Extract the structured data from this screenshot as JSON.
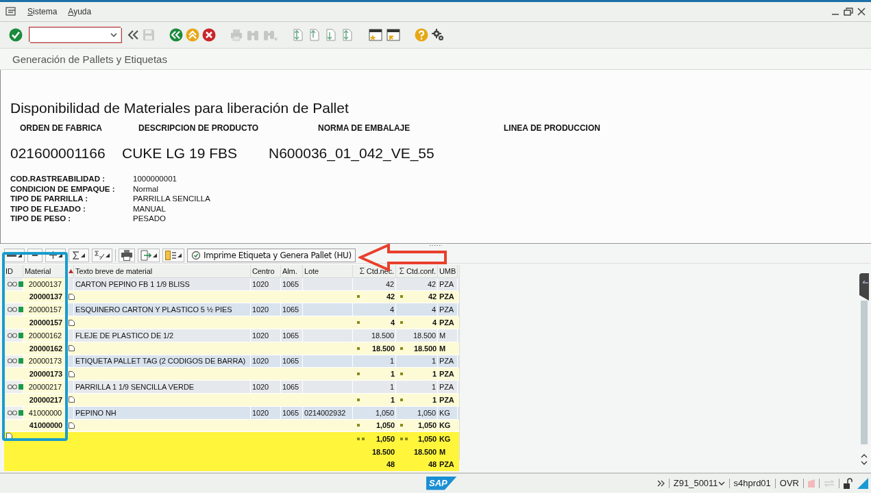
{
  "menu": [
    {
      "label": "Sistema"
    },
    {
      "label": "Ayuda"
    }
  ],
  "screen_title": "Generación de Pallets y Etiquetas",
  "header": {
    "title": "Disponibilidad de Materiales para liberación de Pallet",
    "columns": [
      "ORDEN DE FABRICA",
      "DESCRIPCION DE PRODUCTO",
      "NORMA DE EMBALAJE",
      "LINEA DE PRODUCCION"
    ],
    "values": [
      "021600001166",
      "CUKE LG 19 FBS",
      "N600036_01_042_VE_55"
    ],
    "details": [
      {
        "label": "COD.RASTREABILIDAD :",
        "value": "1000000001"
      },
      {
        "label": "CONDICION DE EMPAQUE :",
        "value": "Normal"
      },
      {
        "label": "TIPO DE PARRILLA :",
        "value": "PARRILLA SENCILLA"
      },
      {
        "label": "TIPO DE FLEJADO :",
        "value": "MANUAL"
      },
      {
        "label": "TIPO DE PESO :",
        "value": "PESADO"
      }
    ]
  },
  "grid": {
    "action_button": "Imprime Etiqueta y Genera Pallet (HU)",
    "columns": [
      {
        "label": "ID",
        "sum": false
      },
      {
        "label": "Material",
        "sum": false
      },
      {
        "label": "Texto breve de material",
        "sum": false
      },
      {
        "label": "Centro",
        "sum": false
      },
      {
        "label": "Alm.",
        "sum": false
      },
      {
        "label": "Lote",
        "sum": false
      },
      {
        "label": "Ctd.nec.",
        "sum": true
      },
      {
        "label": "Ctd.conf.",
        "sum": true
      },
      {
        "label": "UMB",
        "sum": false
      }
    ],
    "rows": [
      {
        "kind": "item",
        "material": "20000137",
        "text": "CARTON PEPINO FB 1 1/9 BLISS",
        "centro": "1020",
        "alm": "1065",
        "lote": "",
        "nec": "42",
        "conf": "42",
        "umb": "PZA"
      },
      {
        "kind": "subtotal",
        "material": "20000137",
        "nec": "42",
        "conf": "42",
        "umb": "PZA"
      },
      {
        "kind": "item",
        "material": "20000157",
        "text": "ESQUINERO CARTON Y PLASTICO 5 ½ PIES",
        "centro": "1020",
        "alm": "1065",
        "lote": "",
        "nec": "4",
        "conf": "4",
        "umb": "PZA"
      },
      {
        "kind": "subtotal",
        "material": "20000157",
        "nec": "4",
        "conf": "4",
        "umb": "PZA"
      },
      {
        "kind": "item",
        "material": "20000162",
        "text": "FLEJE DE PLASTICO DE 1/2",
        "centro": "1020",
        "alm": "1065",
        "lote": "",
        "nec": "18.500",
        "conf": "18.500",
        "umb": "M"
      },
      {
        "kind": "subtotal",
        "material": "20000162",
        "nec": "18.500",
        "conf": "18.500",
        "umb": "M"
      },
      {
        "kind": "item",
        "material": "20000173",
        "text": "ETIQUETA PALLET TAG (2 CODIGOS DE BARRA)",
        "centro": "1020",
        "alm": "1065",
        "lote": "",
        "nec": "1",
        "conf": "1",
        "umb": "PZA"
      },
      {
        "kind": "subtotal",
        "material": "20000173",
        "nec": "1",
        "conf": "1",
        "umb": "PZA"
      },
      {
        "kind": "item",
        "material": "20000217",
        "text": "PARRILLA 1 1/9 SENCILLA VERDE",
        "centro": "1020",
        "alm": "1065",
        "lote": "",
        "nec": "1",
        "conf": "1",
        "umb": "PZA"
      },
      {
        "kind": "subtotal",
        "material": "20000217",
        "nec": "1",
        "conf": "1",
        "umb": "PZA"
      },
      {
        "kind": "item",
        "material": "41000000",
        "text": "PEPINO NH",
        "centro": "1020",
        "alm": "1065",
        "lote": "0214002932",
        "nec": "1,050",
        "conf": "1,050",
        "umb": "KG"
      },
      {
        "kind": "subtotal",
        "material": "41000000",
        "nec": "1,050",
        "conf": "1,050",
        "umb": "KG"
      }
    ],
    "totals": [
      {
        "nec": "1,050",
        "conf": "1,050",
        "umb": "KG"
      },
      {
        "nec": "18.500",
        "conf": "18.500",
        "umb": "M"
      },
      {
        "nec": "48",
        "conf": "48",
        "umb": "PZA"
      }
    ]
  },
  "status_bar": {
    "transaction": "Z91_50011",
    "server": "s4hprd01",
    "mode": "OVR"
  },
  "logo": "SAP"
}
